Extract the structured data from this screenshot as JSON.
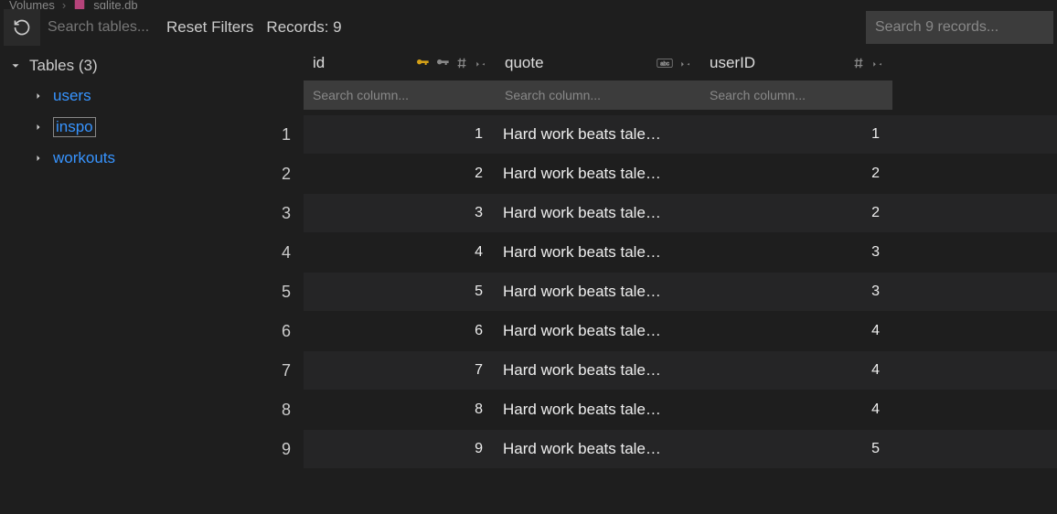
{
  "breadcrumb": {
    "segment1": "Volumes",
    "segment2": "sqlite.db"
  },
  "toolbar": {
    "search_tables_placeholder": "Search tables...",
    "reset_filters_label": "Reset Filters",
    "records_label": "Records: 9",
    "search_records_placeholder": "Search 9 records..."
  },
  "sidebar": {
    "header": "Tables (3)",
    "items": [
      {
        "label": "users",
        "active": false
      },
      {
        "label": "inspo",
        "active": true
      },
      {
        "label": "workouts",
        "active": false
      }
    ]
  },
  "columns": {
    "id": {
      "label": "id",
      "search_placeholder": "Search column..."
    },
    "quote": {
      "label": "quote",
      "search_placeholder": "Search column..."
    },
    "userID": {
      "label": "userID",
      "search_placeholder": "Search column..."
    }
  },
  "rows": [
    {
      "n": "1",
      "id": "1",
      "quote": "Hard work beats tale…",
      "userID": "1"
    },
    {
      "n": "2",
      "id": "2",
      "quote": "Hard work beats tale…",
      "userID": "2"
    },
    {
      "n": "3",
      "id": "3",
      "quote": "Hard work beats tale…",
      "userID": "2"
    },
    {
      "n": "4",
      "id": "4",
      "quote": "Hard work beats tale…",
      "userID": "3"
    },
    {
      "n": "5",
      "id": "5",
      "quote": "Hard work beats tale…",
      "userID": "3"
    },
    {
      "n": "6",
      "id": "6",
      "quote": "Hard work beats tale…",
      "userID": "4"
    },
    {
      "n": "7",
      "id": "7",
      "quote": "Hard work beats tale…",
      "userID": "4"
    },
    {
      "n": "8",
      "id": "8",
      "quote": "Hard work beats tale…",
      "userID": "4"
    },
    {
      "n": "9",
      "id": "9",
      "quote": "Hard work beats tale…",
      "userID": "5"
    }
  ]
}
